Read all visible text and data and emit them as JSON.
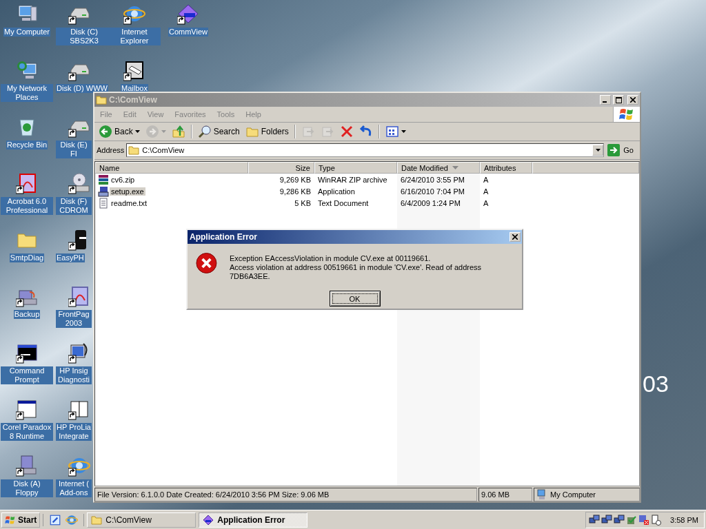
{
  "desktop": {
    "columns": [
      [
        {
          "label": "My Computer",
          "kind": "computer",
          "shortcut": false
        },
        {
          "label": "My Network Places",
          "kind": "network",
          "shortcut": false
        },
        {
          "label": "Recycle Bin",
          "kind": "recycle",
          "shortcut": false
        },
        {
          "label": "Acrobat 6.0 Professional",
          "kind": "acrobat",
          "shortcut": true
        },
        {
          "label": "SmtpDiag",
          "kind": "folder",
          "shortcut": false
        },
        {
          "label": "Backup",
          "kind": "backup",
          "shortcut": true
        },
        {
          "label": "Command Prompt",
          "kind": "cmd",
          "shortcut": true
        },
        {
          "label": "Corel Paradox 8 Runtime",
          "kind": "window",
          "shortcut": true
        },
        {
          "label": "Disk (A) Floppy",
          "kind": "floppy",
          "shortcut": true
        }
      ],
      [
        {
          "label": "Disk (C) SBS2K3",
          "kind": "disk",
          "shortcut": true
        },
        {
          "label": "Disk (D) WWW",
          "kind": "disk",
          "shortcut": true
        },
        {
          "label": "Disk (E) FI",
          "kind": "disk",
          "shortcut": true
        },
        {
          "label": "Disk (F) CDROM",
          "kind": "cdrom",
          "shortcut": true
        },
        {
          "label": "EasyPH",
          "kind": "easyphp",
          "shortcut": true
        },
        {
          "label": "FrontPag 2003",
          "kind": "frontpage",
          "shortcut": true
        },
        {
          "label": "HP Insig Diagnosti",
          "kind": "monitor",
          "shortcut": true
        },
        {
          "label": "HP ProLia Integrate",
          "kind": "book",
          "shortcut": true
        },
        {
          "label": "Internet ( Add-ons",
          "kind": "ie",
          "shortcut": true
        }
      ],
      [
        {
          "label": "Internet Explorer",
          "kind": "ie",
          "shortcut": true
        },
        {
          "label": "Mailbox",
          "kind": "mailbox",
          "shortcut": true
        }
      ],
      [
        {
          "label": "CommView",
          "kind": "commview",
          "shortcut": true
        }
      ]
    ],
    "wallpaper_text": "03"
  },
  "explorer": {
    "title": "C:\\ComView",
    "menu": [
      "File",
      "Edit",
      "View",
      "Favorites",
      "Tools",
      "Help"
    ],
    "toolbar": [
      {
        "kind": "back",
        "label": "Back",
        "disabled": false
      },
      {
        "kind": "forward",
        "disabled": true
      },
      {
        "kind": "up",
        "disabled": false
      },
      {
        "kind": "search",
        "label": "Search",
        "disabled": false
      },
      {
        "kind": "folders",
        "label": "Folders",
        "disabled": false
      },
      {
        "kind": "moveto",
        "disabled": true
      },
      {
        "kind": "copyto",
        "disabled": true
      },
      {
        "kind": "delete",
        "disabled": false
      },
      {
        "kind": "undo",
        "disabled": false
      },
      {
        "kind": "views",
        "disabled": false
      }
    ],
    "address": {
      "label": "Address",
      "value": "C:\\ComView",
      "go": "Go"
    },
    "columns": [
      {
        "label": "Name",
        "sorted": false
      },
      {
        "label": "Size",
        "sorted": false
      },
      {
        "label": "Type",
        "sorted": false
      },
      {
        "label": "Date Modified",
        "sorted": true
      },
      {
        "label": "Attributes",
        "sorted": false
      }
    ],
    "rows": [
      {
        "kind": "zip",
        "cells": [
          "cv6.zip",
          "9,269 KB",
          "WinRAR ZIP archive",
          "6/24/2010 3:55 PM",
          "A"
        ],
        "selected": false
      },
      {
        "kind": "exe",
        "cells": [
          "setup.exe",
          "9,286 KB",
          "Application",
          "6/16/2010 7:04 PM",
          "A"
        ],
        "selected": true
      },
      {
        "kind": "txt",
        "cells": [
          "readme.txt",
          "5 KB",
          "Text Document",
          "6/4/2009 1:24 PM",
          "A"
        ],
        "selected": false
      }
    ],
    "status": {
      "info": "File Version: 6.1.0.0 Date Created: 6/24/2010 3:56 PM Size: 9.06 MB",
      "size": "9.06 MB",
      "zone": "My Computer"
    }
  },
  "dialog": {
    "title": "Application Error",
    "lines": [
      "Exception EAccessViolation in module CV.exe at 00119661.",
      "Access violation at address 00519661 in module 'CV.exe'. Read of address 7DB6A3EE."
    ],
    "button": "OK"
  },
  "taskbar": {
    "start": "Start",
    "tasks": [
      {
        "label": "C:\\ComView",
        "kind": "folder",
        "selected": false
      },
      {
        "label": "Application Error",
        "kind": "commview",
        "selected": true
      }
    ],
    "clock": "3:58 PM"
  }
}
